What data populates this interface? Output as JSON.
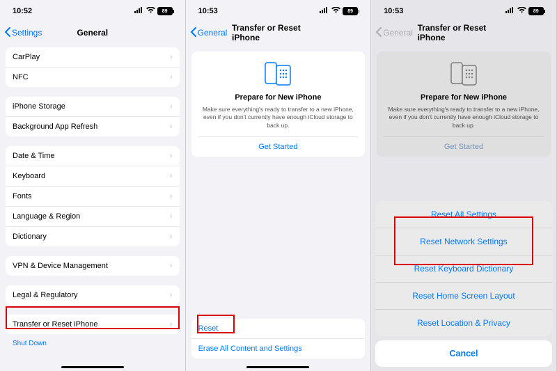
{
  "status": {
    "time_a": "10:52",
    "time_b": "10:53",
    "time_c": "10:53",
    "battery": "89"
  },
  "s1": {
    "back": "Settings",
    "title": "General",
    "g1": [
      "CarPlay",
      "NFC"
    ],
    "g2": [
      "iPhone Storage",
      "Background App Refresh"
    ],
    "g3": [
      "Date & Time",
      "Keyboard",
      "Fonts",
      "Language & Region",
      "Dictionary"
    ],
    "g4": [
      "VPN & Device Management"
    ],
    "g5": [
      "Legal & Regulatory"
    ],
    "g6": [
      "Transfer or Reset iPhone"
    ],
    "shutdown": "Shut Down"
  },
  "s2": {
    "back": "General",
    "title": "Transfer or Reset iPhone",
    "card_title": "Prepare for New iPhone",
    "card_body": "Make sure everything's ready to transfer to a new iPhone, even if you don't currently have enough iCloud storage to back up.",
    "get_started": "Get Started",
    "reset": "Reset",
    "erase": "Erase All Content and Settings"
  },
  "s3": {
    "back": "General",
    "title": "Transfer or Reset iPhone",
    "card_title": "Prepare for New iPhone",
    "card_body": "Make sure everything's ready to transfer to a new iPhone, even if you don't currently have enough iCloud storage to back up.",
    "get_started": "Get Started",
    "opts": [
      "Reset All Settings",
      "Reset Network Settings",
      "Reset Keyboard Dictionary",
      "Reset Home Screen Layout",
      "Reset Location & Privacy"
    ],
    "cancel": "Cancel"
  }
}
